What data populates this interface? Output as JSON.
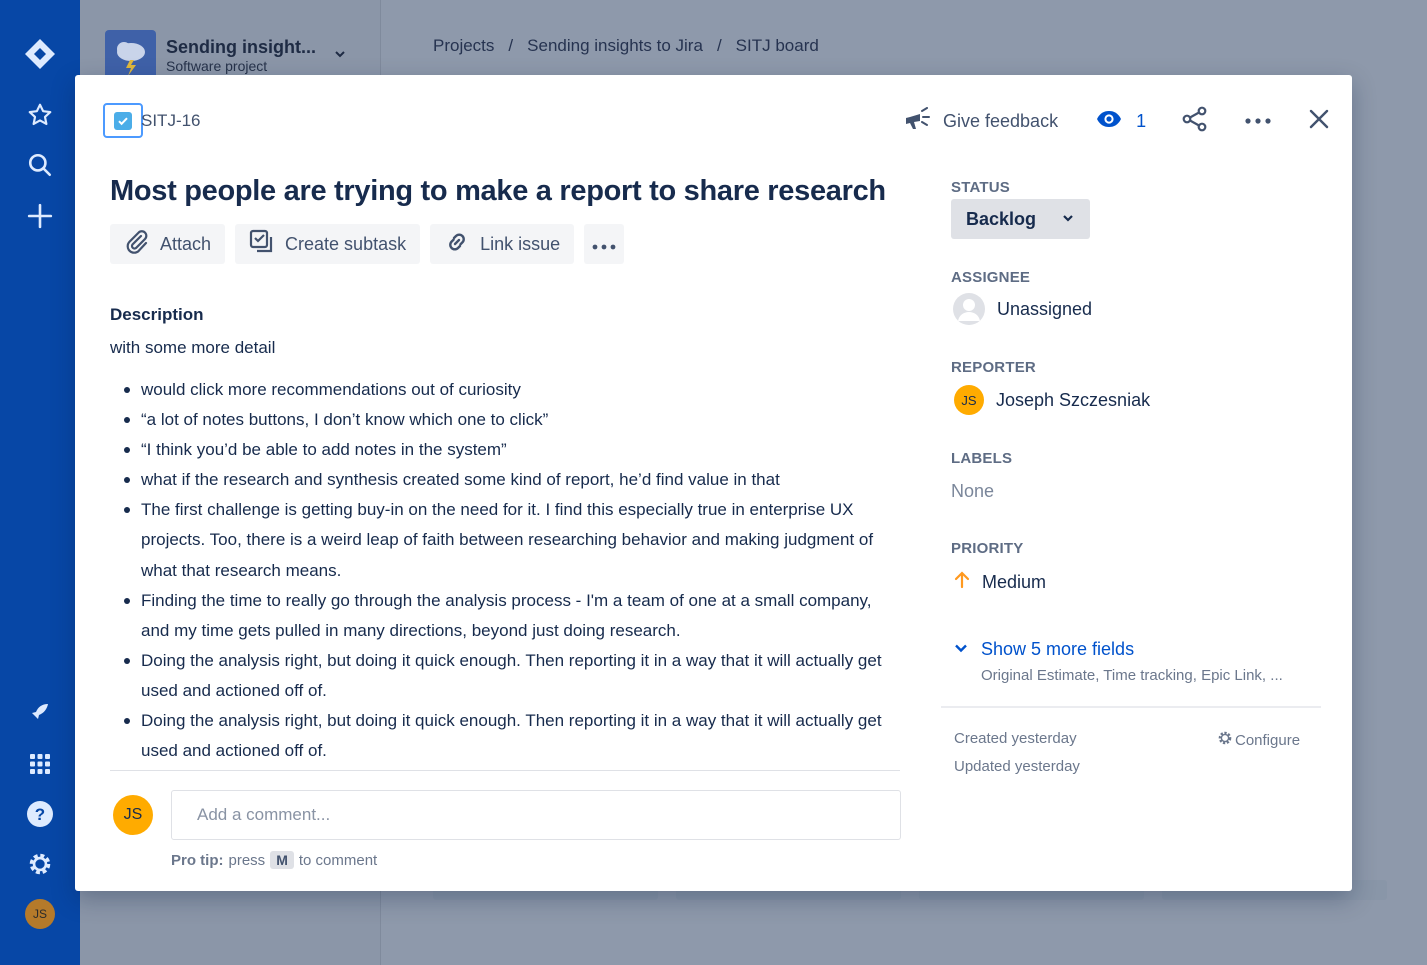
{
  "project": {
    "name": "Sending insight...",
    "type": "Software project"
  },
  "breadcrumb": [
    "Projects",
    "Sending insights to Jira",
    "SITJ board"
  ],
  "issue": {
    "key": "SITJ-16",
    "summary": "Most people are trying to make a report to share research",
    "watchers": "1"
  },
  "top_actions": {
    "feedback": "Give feedback"
  },
  "actions": {
    "attach": "Attach",
    "subtask": "Create subtask",
    "link": "Link issue"
  },
  "description": {
    "heading": "Description",
    "intro": "with some more detail",
    "bullets": [
      "would click more recommendations out of curiosity",
      "“a lot of notes buttons, I don’t know which one to click”",
      "“I think you’d be able to add notes in the system”",
      "what if the research and synthesis created some kind of report, he’d find value in that",
      "The first challenge is getting buy-in on the need for it. I find this especially true in enterprise UX projects. Too, there is a weird leap of faith between researching behavior and making judgment of what that research means.",
      "Finding the time to really go through the analysis process - I'm a team of one at a small company, and my time gets pulled in many directions, beyond just doing research.",
      "Doing the analysis right, but doing it quick enough. Then reporting it in a way that it will actually get used and actioned off of.",
      "Doing the analysis right, but doing it quick enough. Then reporting it in a way that it will actually get used and actioned off of."
    ]
  },
  "comment": {
    "avatar_initials": "JS",
    "placeholder": "Add a comment...",
    "tip_label": "Pro tip:",
    "tip_press": "press",
    "tip_key": "M",
    "tip_suffix": "to comment"
  },
  "fields": {
    "status_label": "STATUS",
    "status_value": "Backlog",
    "assignee_label": "ASSIGNEE",
    "assignee_value": "Unassigned",
    "reporter_label": "REPORTER",
    "reporter_value": "Joseph Szczesniak",
    "reporter_initials": "JS",
    "labels_label": "LABELS",
    "labels_value": "None",
    "priority_label": "PRIORITY",
    "priority_value": "Medium",
    "more_fields": "Show 5 more fields",
    "more_fields_sub": "Original Estimate, Time tracking, Epic Link, ...",
    "created": "Created yesterday",
    "updated": "Updated yesterday",
    "configure": "Configure"
  },
  "nav": {
    "user_initials": "JS"
  },
  "colors": {
    "nav": "#0747a6",
    "link": "#0052cc",
    "avatar": "#ffab00",
    "priority": "#ff991f"
  }
}
